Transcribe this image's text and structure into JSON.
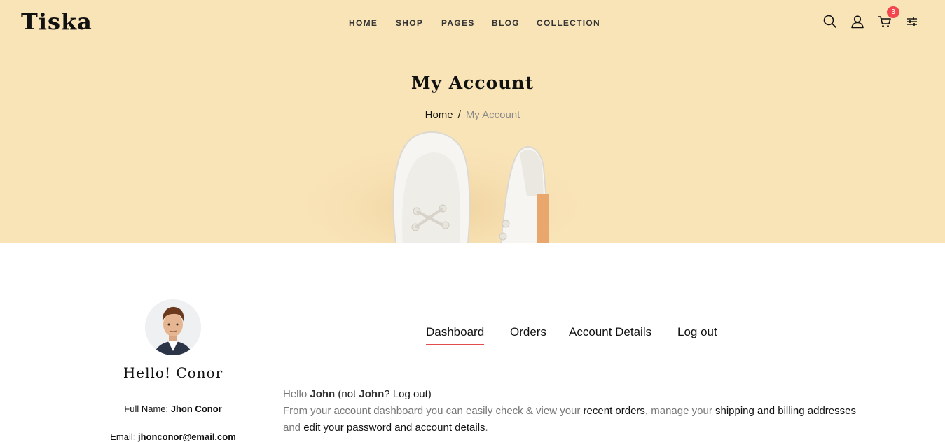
{
  "brand": {
    "name": "Tiska"
  },
  "nav": {
    "items": [
      {
        "label": "HOME"
      },
      {
        "label": "SHOP"
      },
      {
        "label": "PAGES"
      },
      {
        "label": "BLOG"
      },
      {
        "label": "COLLECTION"
      }
    ]
  },
  "header_icons": {
    "search": "search-icon",
    "account": "user-icon",
    "cart": "cart-icon",
    "settings": "sliders-icon",
    "cart_count": "3"
  },
  "hero": {
    "title": "My Account",
    "breadcrumb": {
      "home": "Home",
      "separator": "/",
      "current": "My Account"
    },
    "background_color": "#f9e4b8"
  },
  "profile": {
    "greeting": "Hello! Conor",
    "full_name_label": "Full Name:",
    "full_name": "Jhon Conor",
    "email_label": "Email:",
    "email": "jhonconor@email.com"
  },
  "tabs": [
    {
      "label": "Dashboard",
      "active": true
    },
    {
      "label": "Orders",
      "active": false
    },
    {
      "label": "Account Details",
      "active": false
    },
    {
      "label": "Log out",
      "active": false
    }
  ],
  "dashboard": {
    "hello_prefix": "Hello",
    "user": "John",
    "not_prefix": "(not",
    "not_user": "John",
    "logout_suffix": "? Log out)",
    "intro": "From your account dashboard you can easily check & view your",
    "recent_orders": "recent orders",
    "comma_manage": ", manage your",
    "shipping_billing": "shipping and billing",
    "addresses": "addresses",
    "and": "and",
    "edit_details": "edit your password and account details",
    "period": "."
  },
  "colors": {
    "accent": "#e24c4c",
    "badge": "#f3474f"
  }
}
